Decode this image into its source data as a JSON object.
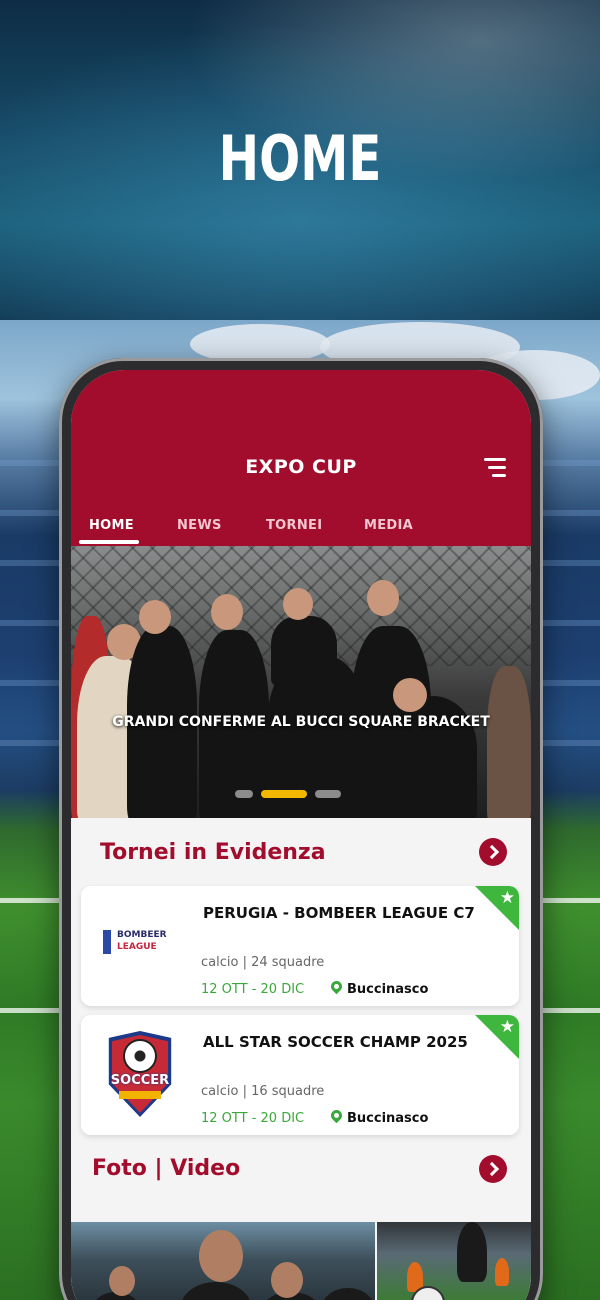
{
  "banner": {
    "title": "HOME"
  },
  "app": {
    "title": "EXPO CUP",
    "menu_icon": "hamburger-menu-icon",
    "tabs": [
      {
        "label": "HOME",
        "active": true
      },
      {
        "label": "NEWS",
        "active": false
      },
      {
        "label": "TORNEI",
        "active": false
      },
      {
        "label": "MEDIA",
        "active": false
      }
    ]
  },
  "hero": {
    "caption": "GRANDI CONFERME AL BUCCI SQUARE BRACKET",
    "slides_count": 3,
    "active_slide": 1
  },
  "featured": {
    "title": "Tornei in Evidenza",
    "cards": [
      {
        "name": "PERUGIA - BOMBEER LEAGUE C7",
        "logo": "bombeer-league-logo",
        "logo_text_1": "BOMBEER",
        "logo_text_2": "LEAGUE",
        "sport": "calcio",
        "teams": "24 squadre",
        "meta": "calcio | 24 squadre",
        "dates": "12 OTT - 20 DIC",
        "location": "Buccinasco",
        "star": "★"
      },
      {
        "name": "ALL STAR SOCCER CHAMP 2025",
        "logo": "soccer-championship-logo",
        "logo_text": "SOCCER",
        "sport": "calcio",
        "teams": "16 squadre",
        "meta": "calcio | 16 squadre",
        "dates": "12 OTT - 20 DIC",
        "location": "Buccinasco",
        "star": "★"
      }
    ]
  },
  "media": {
    "title": "Foto | Video"
  },
  "colors": {
    "primary": "#a30d2d",
    "accent_green": "#3fb73f",
    "dot_active": "#f2b800"
  }
}
